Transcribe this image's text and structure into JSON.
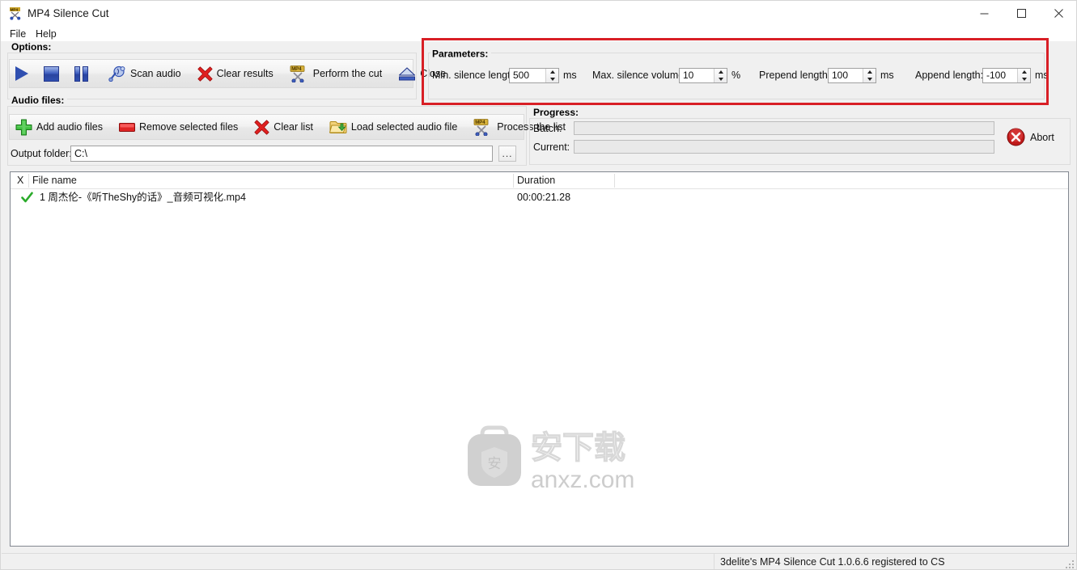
{
  "window": {
    "title": "MP4 Silence Cut",
    "app_icon": "mp4-scissors-icon",
    "controls": {
      "minimize": "minimize-icon",
      "maximize": "maximize-icon",
      "close": "close-icon"
    }
  },
  "menu": {
    "items": [
      {
        "label": "File"
      },
      {
        "label": "Help"
      }
    ]
  },
  "options": {
    "group_title": "Options:",
    "buttons": [
      {
        "label": "",
        "icon": "play-icon"
      },
      {
        "label": "",
        "icon": "stop-icon"
      },
      {
        "label": "",
        "icon": "pause-icon"
      },
      {
        "label": "Scan audio",
        "icon": "scan-audio-icon"
      },
      {
        "label": "Clear results",
        "icon": "red-x-icon"
      },
      {
        "label": "Perform the cut",
        "icon": "mp4-cut-icon"
      },
      {
        "label": "Close",
        "icon": "eject-icon"
      }
    ]
  },
  "parameters": {
    "group_title": "Parameters:",
    "highlight_color": "#d81f26",
    "fields": [
      {
        "label": "Min. silence length:",
        "value": "500",
        "unit": "ms"
      },
      {
        "label": "Max. silence volume:",
        "value": "10",
        "unit": "%"
      },
      {
        "label": "Prepend length:",
        "value": "100",
        "unit": "ms"
      },
      {
        "label": "Append length:",
        "value": "-100",
        "unit": "ms"
      }
    ]
  },
  "audio_files": {
    "group_title": "Audio files:",
    "buttons": [
      {
        "label": "Add audio files",
        "icon": "green-plus-icon"
      },
      {
        "label": "Remove selected files",
        "icon": "red-bar-icon"
      },
      {
        "label": "Clear list",
        "icon": "red-x-icon"
      },
      {
        "label": "Load selected audio file",
        "icon": "open-folder-icon"
      },
      {
        "label": "Process the list",
        "icon": "mp4-cut-icon"
      }
    ],
    "output_folder": {
      "label": "Output folder:",
      "value": "C:\\",
      "browse_label": "..."
    }
  },
  "progress": {
    "group_title": "Progress:",
    "batch": {
      "label": "Batch:",
      "value": ""
    },
    "current": {
      "label": "Current:",
      "value": ""
    },
    "abort": {
      "label": "Abort",
      "icon": "abort-icon"
    }
  },
  "file_list": {
    "columns": [
      {
        "key": "x",
        "label": "X"
      },
      {
        "key": "name",
        "label": "File name"
      },
      {
        "key": "duration",
        "label": "Duration"
      }
    ],
    "rows": [
      {
        "checked": "check-icon",
        "name": "1 周杰伦-《听TheShy的话》_音频可视化.mp4",
        "duration": "00:00:21.28"
      }
    ]
  },
  "watermark": {
    "text": "anxz.com",
    "logo_char": "安"
  },
  "status_bar": {
    "cells": [
      {
        "text": ""
      },
      {
        "text": "3delite's MP4 Silence Cut 1.0.6.6 registered to CS"
      }
    ]
  }
}
